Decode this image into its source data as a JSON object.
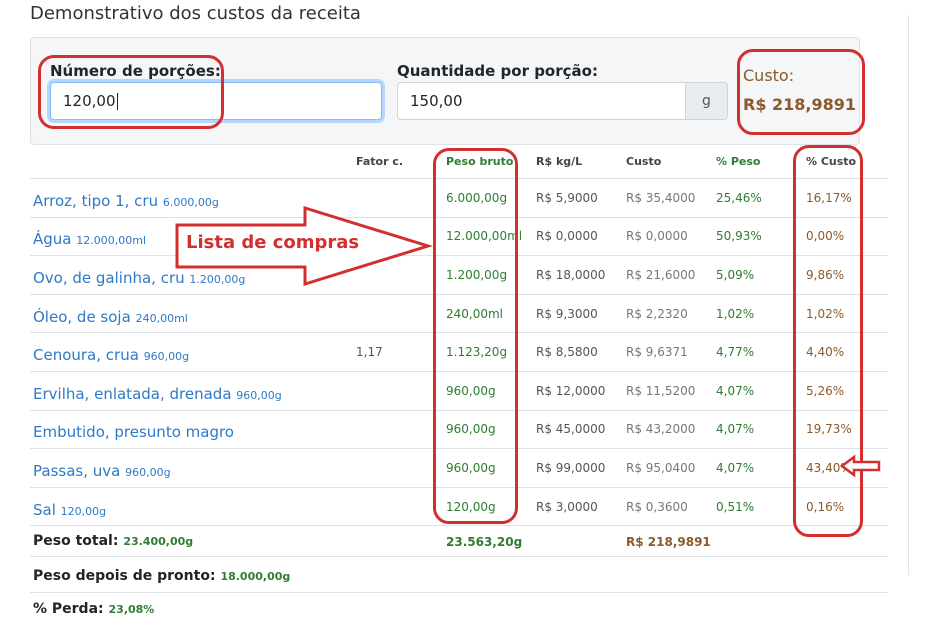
{
  "page": {
    "title": "Demonstrativo dos custos da receita"
  },
  "form": {
    "portions_label": "Número de porções:",
    "portions_value": "120,00",
    "quantity_label": "Quantidade por porção:",
    "quantity_value": "150,00",
    "quantity_unit": "g",
    "cost_label": "Custo:",
    "cost_value": "R$ 218,9891"
  },
  "table": {
    "columns": [
      "Fator c.",
      "Peso bruto",
      "R$ kg/L",
      "Custo",
      "% Peso",
      "% Custo"
    ],
    "rows": [
      {
        "name": "Arroz, tipo 1, cru",
        "qty": "6.000,00g",
        "factor": "",
        "gross": "6.000,00g",
        "price": "R$ 5,9000",
        "cost": "R$ 35,4000",
        "pct_weight": "25,46%",
        "pct_cost": "16,17%"
      },
      {
        "name": "Água",
        "qty": "12.000,00ml",
        "factor": "",
        "gross": "12.000,00ml",
        "price": "R$ 0,0000",
        "cost": "R$ 0,0000",
        "pct_weight": "50,93%",
        "pct_cost": "0,00%"
      },
      {
        "name": "Ovo, de galinha, cru",
        "qty": "1.200,00g",
        "factor": "",
        "gross": "1.200,00g",
        "price": "R$ 18,0000",
        "cost": "R$ 21,6000",
        "pct_weight": "5,09%",
        "pct_cost": "9,86%"
      },
      {
        "name": "Óleo, de soja",
        "qty": "240,00ml",
        "factor": "",
        "gross": "240,00ml",
        "price": "R$ 9,3000",
        "cost": "R$ 2,2320",
        "pct_weight": "1,02%",
        "pct_cost": "1,02%"
      },
      {
        "name": "Cenoura, crua",
        "qty": "960,00g",
        "factor": "1,17",
        "gross": "1.123,20g",
        "price": "R$ 8,5800",
        "cost": "R$ 9,6371",
        "pct_weight": "4,77%",
        "pct_cost": "4,40%"
      },
      {
        "name": "Ervilha, enlatada, drenada",
        "qty": "960,00g",
        "factor": "",
        "gross": "960,00g",
        "price": "R$ 12,0000",
        "cost": "R$ 11,5200",
        "pct_weight": "4,07%",
        "pct_cost": "5,26%"
      },
      {
        "name": "Embutido, presunto magro",
        "qty": "",
        "factor": "",
        "gross": "960,00g",
        "price": "R$ 45,0000",
        "cost": "R$ 43,2000",
        "pct_weight": "4,07%",
        "pct_cost": "19,73%"
      },
      {
        "name": "Passas, uva",
        "qty": "960,00g",
        "factor": "",
        "gross": "960,00g",
        "price": "R$ 99,0000",
        "cost": "R$ 95,0400",
        "pct_weight": "4,07%",
        "pct_cost": "43,40%"
      },
      {
        "name": "Sal",
        "qty": "120,00g",
        "factor": "",
        "gross": "120,00g",
        "price": "R$ 3,0000",
        "cost": "R$ 0,3600",
        "pct_weight": "0,51%",
        "pct_cost": "0,16%"
      }
    ]
  },
  "totals": {
    "total_weight_label": "Peso total:",
    "total_weight_value": "23.400,00g",
    "total_gross": "23.563,20g",
    "total_cost": "R$ 218,9891",
    "ready_weight_label": "Peso depois de pronto:",
    "ready_weight_value": "18.000,00g",
    "loss_label": "% Perda:",
    "loss_value": "23,08%"
  },
  "annotations": {
    "shopping_list": "Lista de compras"
  }
}
